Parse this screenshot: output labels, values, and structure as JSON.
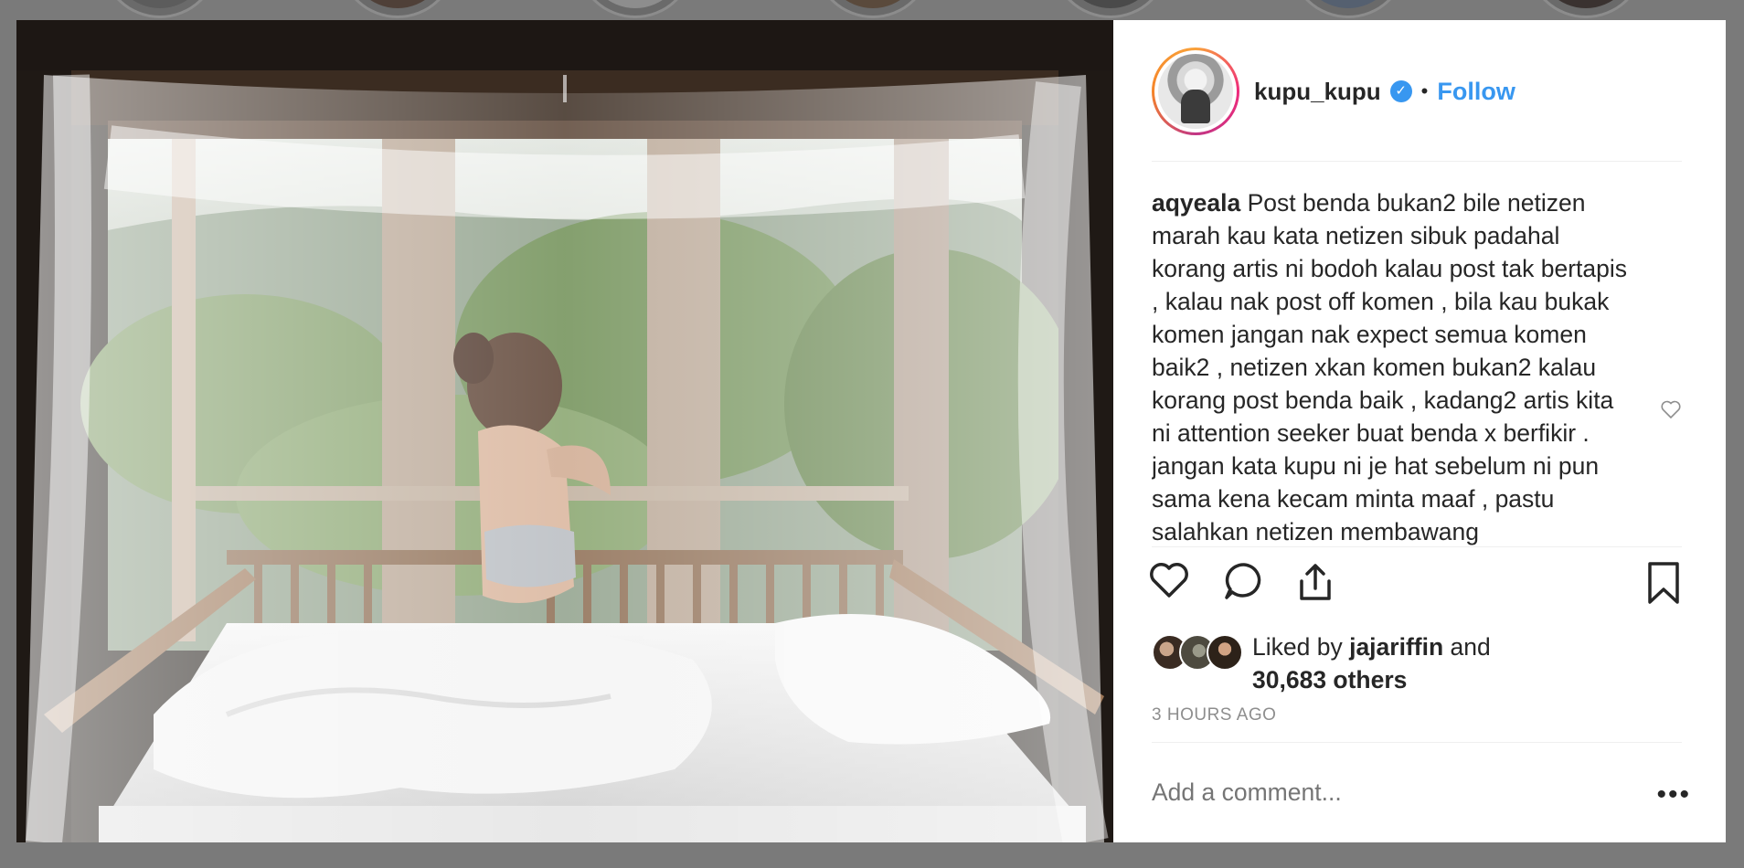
{
  "post": {
    "username": "kupu_kupu",
    "verified_label": "✓",
    "dot": "•",
    "follow_label": "Follow"
  },
  "comment": {
    "author": "aqyeala",
    "text": "Post benda bukan2 bile netizen marah kau kata netizen sibuk padahal korang artis ni bodoh kalau post tak bertapis , kalau nak post off komen , bila kau bukak komen jangan nak expect semua komen baik2 , netizen xkan komen bukan2 kalau korang post benda baik , kadang2 artis kita ni attention seeker buat benda x berfikir . jangan kata kupu ni je hat sebelum ni pun sama kena kecam minta maaf , pastu salahkan netizen membawang"
  },
  "likes": {
    "prefix": "Liked by",
    "liker": "jajariffin",
    "and": "and",
    "others": "30,683 others"
  },
  "timestamp": "3 HOURS AGO",
  "add_comment": {
    "placeholder": "Add a comment..."
  },
  "more_label": "•••",
  "icons": {
    "like": "heart-icon",
    "comment": "comment-icon",
    "share": "share-icon",
    "save": "bookmark-icon",
    "comment_like": "small-heart-icon"
  },
  "colors": {
    "accent": "#3897f0",
    "text": "#262626",
    "muted": "#8e8e8e",
    "backdrop": "#7a7a7a"
  }
}
